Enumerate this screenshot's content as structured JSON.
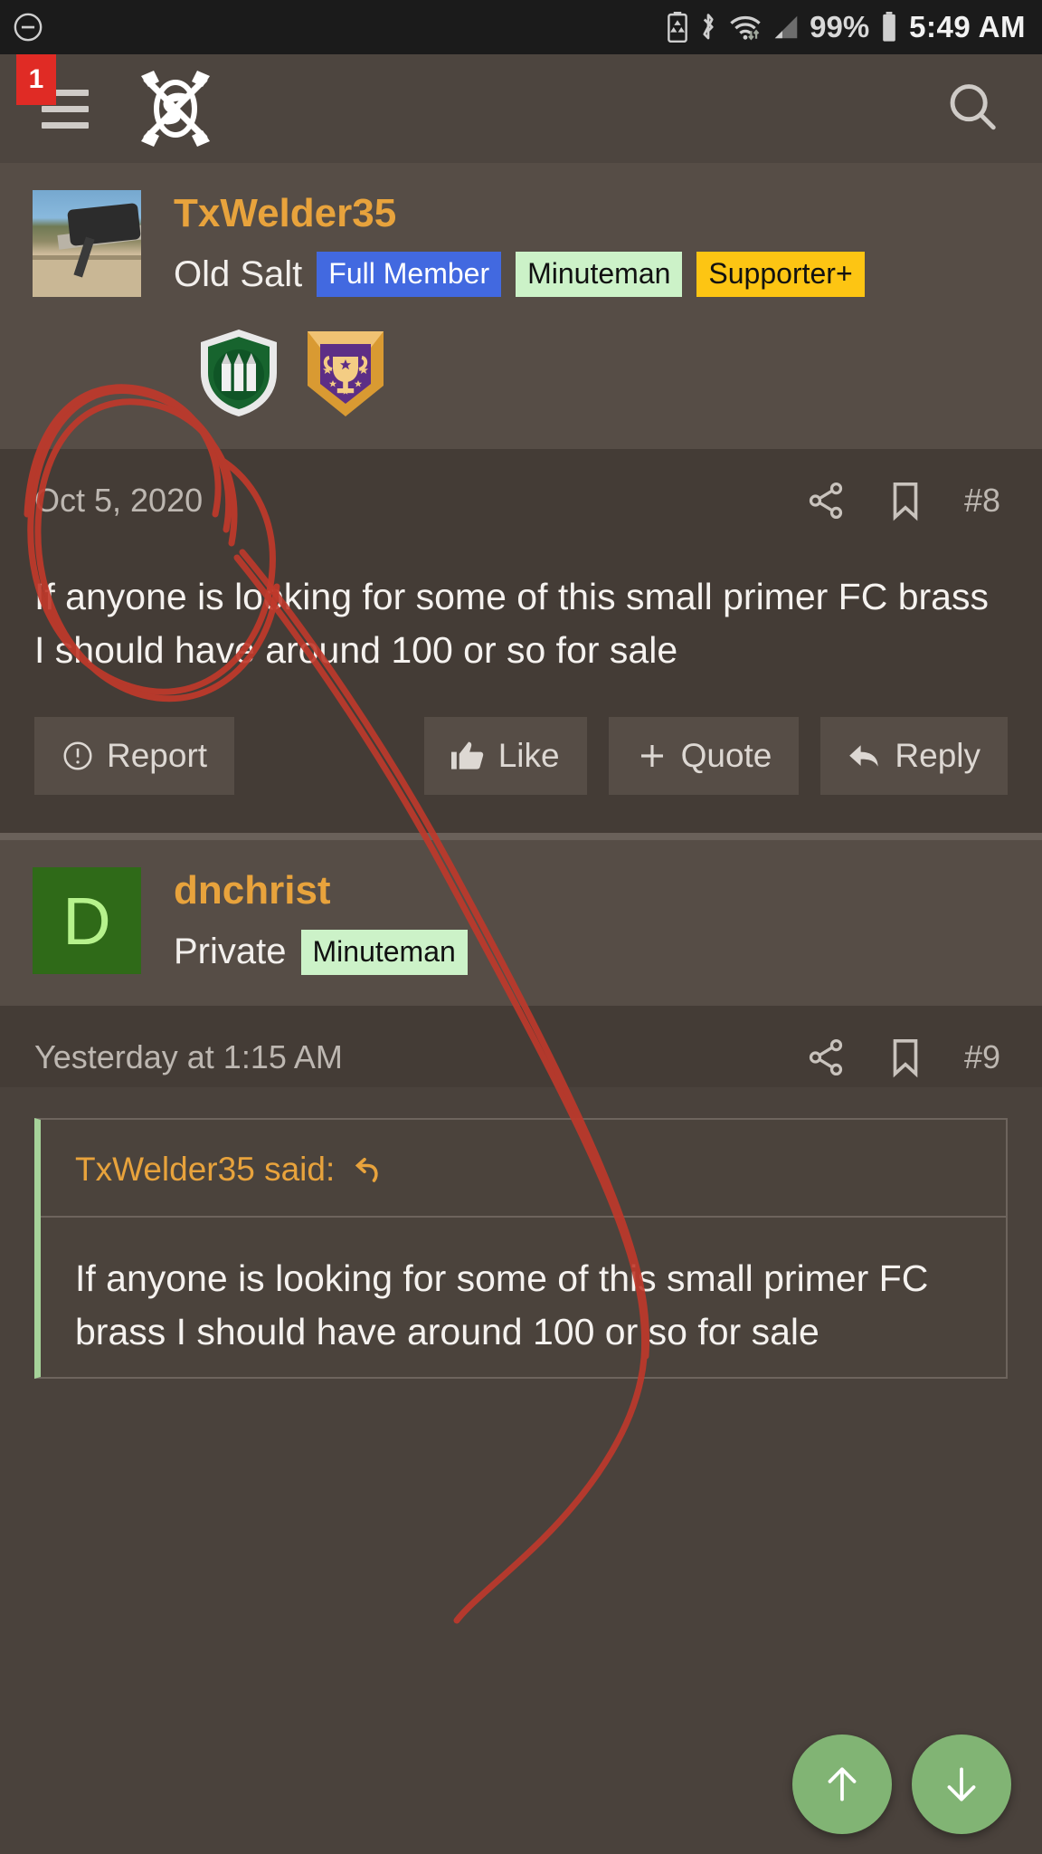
{
  "status_bar": {
    "left_icon": "minus-circle-icon",
    "icons": [
      "battery-saver-icon",
      "bluetooth-icon",
      "wifi-icon",
      "cell-signal-icon"
    ],
    "battery_percent": "99%",
    "battery_icon": "battery-full-icon",
    "time": "5:49 AM"
  },
  "app_bar": {
    "notification_count": "1",
    "menu_icon": "hamburger-menu-icon",
    "logo_icon": "sniper-hide-logo-icon",
    "search_icon": "search-icon"
  },
  "posts": [
    {
      "username": "TxWelder35",
      "avatar_type": "photo",
      "avatar_label": "",
      "user_title": "Old Salt",
      "pills": [
        {
          "label": "Full Member",
          "style": "blue"
        },
        {
          "label": "Minuteman",
          "style": "green"
        },
        {
          "label": "Supporter+",
          "style": "gold"
        }
      ],
      "trophies": [
        "ammo-shield-badge-icon",
        "trophy-shield-badge-icon"
      ],
      "date": "Oct 5, 2020",
      "share_icon": "share-icon",
      "bookmark_icon": "bookmark-icon",
      "post_number": "#8",
      "body": "If anyone is looking for some of this small primer FC brass I should have around 100 or so for sale",
      "actions": [
        {
          "label": "Report",
          "icon": "warning-circle-icon"
        },
        {
          "label": "Like",
          "icon": "thumbs-up-icon"
        },
        {
          "label": "Quote",
          "icon": "plus-icon"
        },
        {
          "label": "Reply",
          "icon": "reply-arrow-icon"
        }
      ]
    },
    {
      "username": "dnchrist",
      "avatar_type": "letter",
      "avatar_label": "D",
      "user_title": "Private",
      "pills": [
        {
          "label": "Minuteman",
          "style": "green"
        }
      ],
      "trophies": [],
      "date": "Yesterday at 1:15 AM",
      "share_icon": "share-icon",
      "bookmark_icon": "bookmark-icon",
      "post_number": "#9",
      "quote": {
        "header": "TxWelder35 said:",
        "jump_icon": "jump-to-quote-icon",
        "text": "If anyone is looking for some of this small primer FC brass I should have around 100 or so for sale"
      }
    }
  ],
  "fab": {
    "scroll_up_icon": "arrow-up-icon",
    "scroll_down_icon": "arrow-down-icon"
  },
  "annotation": {
    "type": "hand-drawn-red-marker",
    "color": "#c0392b",
    "description": "red circle around post date with trailing line down the page"
  },
  "colors": {
    "status_bar_bg": "#1b1b1b",
    "app_bar_bg": "#4d453f",
    "post_head_bg": "#564d46",
    "post_body_bg": "#443c36",
    "username": "#e8a33c",
    "notification_badge": "#e02b25",
    "pill_blue": "#4269e0",
    "pill_green": "#ccf2c8",
    "pill_gold": "#fdc513",
    "fab_green": "#81b474",
    "quote_accent": "#a6d39a"
  }
}
